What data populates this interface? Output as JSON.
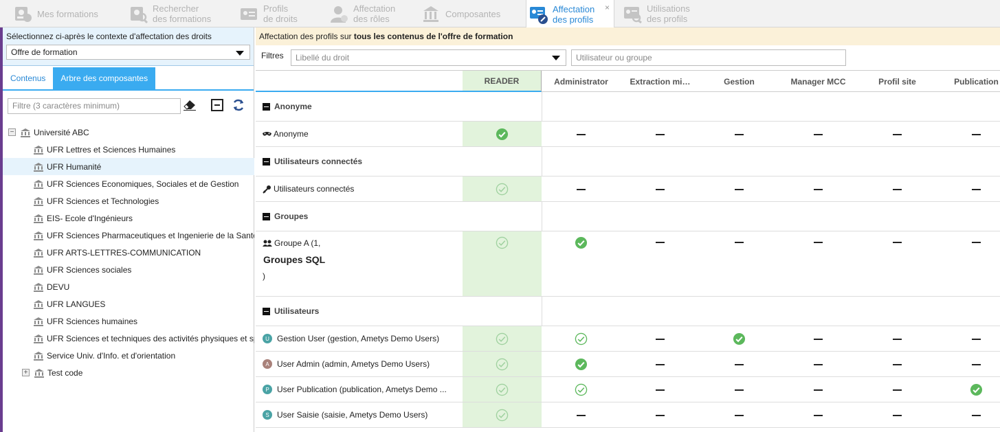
{
  "tabs": [
    {
      "line1": "Mes formations",
      "line2": ""
    },
    {
      "line1": "Rechercher",
      "line2": "des formations"
    },
    {
      "line1": "Profils",
      "line2": "de droits"
    },
    {
      "line1": "Affectation",
      "line2": "des rôles"
    },
    {
      "line1": "Composantes",
      "line2": ""
    },
    {
      "line1": "Affectation",
      "line2": "des profils",
      "close": "×"
    },
    {
      "line1": "Utilisations",
      "line2": "des profils"
    }
  ],
  "left": {
    "context_label": "Sélectionnez ci-après le contexte d'affectation des droits",
    "context_value": "Offre de formation",
    "tabs": [
      "Contenus",
      "Arbre des composantes"
    ],
    "filter_placeholder": "Filtre (3 caractères minimum)",
    "tree": [
      {
        "label": "Université ABC",
        "expander": "−"
      },
      {
        "label": "UFR Lettres et Sciences Humaines"
      },
      {
        "label": "UFR Humanité"
      },
      {
        "label": "UFR Sciences Economiques, Sociales et de Gestion"
      },
      {
        "label": "UFR Sciences et Technologies"
      },
      {
        "label": "EIS- Ecole d'Ingénieurs"
      },
      {
        "label": "UFR Sciences Pharmaceutiques et Ingenierie de la Santé"
      },
      {
        "label": "UFR ARTS-LETTRES-COMMUNICATION"
      },
      {
        "label": "UFR Sciences sociales"
      },
      {
        "label": "DEVU"
      },
      {
        "label": "UFR LANGUES"
      },
      {
        "label": "UFR Sciences humaines"
      },
      {
        "label": "UFR Sciences et techniques des activités physiques et sportives"
      },
      {
        "label": "Service Univ. d'Info. et d'orientation"
      },
      {
        "label": "Test code",
        "expander": "+"
      }
    ]
  },
  "right": {
    "banner_prefix": "Affectation des profils sur ",
    "banner_bold": "tous les contenus de l'offre de formation",
    "filters_label": "Filtres",
    "right_filter_placeholder": "Libellé du droit",
    "user_filter_placeholder": "Utilisateur ou groupe",
    "columns": [
      "READER",
      "Administrator",
      "Extraction mi…",
      "Gestion",
      "Manager MCC",
      "Profil site",
      "Publication"
    ],
    "rows": [
      {
        "type": "group",
        "label": "Anonyme"
      },
      {
        "type": "entry",
        "icon": "mask-icon",
        "label": "Anonyme",
        "marks": [
          "check-filled",
          "dash",
          "dash",
          "dash",
          "dash",
          "dash",
          "dash"
        ]
      },
      {
        "type": "group",
        "label": "Utilisateurs connectés"
      },
      {
        "type": "entry",
        "icon": "key-icon",
        "label": "Utilisateurs connectés",
        "marks": [
          "check-outline",
          "dash",
          "dash",
          "dash",
          "dash",
          "dash",
          "dash"
        ]
      },
      {
        "type": "group",
        "label": "Groupes"
      },
      {
        "type": "entry",
        "icon": "users-icon",
        "label": "Groupe A (1,",
        "label2": "Groupes SQL",
        "label3": ")",
        "marks": [
          "check-outline",
          "check-filled",
          "dash",
          "dash",
          "dash",
          "dash",
          "dash"
        ]
      },
      {
        "type": "group",
        "label": "Utilisateurs"
      },
      {
        "type": "entry",
        "avatar": "U",
        "avatar_color": "#4aa3a5",
        "label": "Gestion User (gestion, Ametys Demo Users)",
        "marks": [
          "check-outline",
          "check-outline",
          "dash",
          "check-filled",
          "dash",
          "dash",
          "dash"
        ]
      },
      {
        "type": "entry",
        "avatar": "A",
        "avatar_color": "#a9817a",
        "label": "User Admin (admin, Ametys Demo Users)",
        "marks": [
          "check-outline",
          "check-filled",
          "dash",
          "dash",
          "dash",
          "dash",
          "dash"
        ]
      },
      {
        "type": "entry",
        "avatar": "P",
        "avatar_color": "#4aa3a5",
        "label": "User Publication (publication, Ametys Demo ...",
        "marks": [
          "check-outline",
          "check-outline",
          "dash",
          "dash",
          "dash",
          "dash",
          "check-filled"
        ]
      },
      {
        "type": "entry",
        "avatar": "S",
        "avatar_color": "#4aa3a5",
        "label": "User Saisie (saisie, Ametys Demo Users)",
        "marks": [
          "check-outline",
          "dash",
          "dash",
          "dash",
          "dash",
          "dash",
          "dash"
        ]
      }
    ]
  },
  "colors": {
    "accent": "#3aabf0",
    "check": "#5cb85c",
    "reader_bg": "#e2f3dc",
    "banner_bg": "#fbf1d9"
  }
}
